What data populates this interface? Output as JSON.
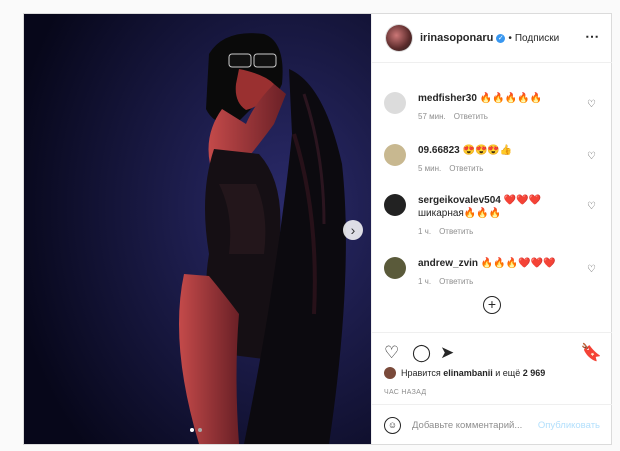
{
  "header": {
    "username": "irinasoponaru",
    "verified": "✓",
    "separator": "•",
    "follow_label": "Подписки",
    "more_icon": "⋯"
  },
  "comments": [
    {
      "user": "medfisher30",
      "text": "🔥🔥🔥🔥🔥",
      "time": "57 мин.",
      "reply": "Ответить",
      "avatar_color": "#dcdcdc"
    },
    {
      "user": "09.66823",
      "text": "😍😍😍👍",
      "time": "5 мин.",
      "reply": "Ответить",
      "avatar_color": "#c8b890"
    },
    {
      "user": "sergeikovalev504",
      "text": "❤️❤️❤️ шикарная🔥🔥🔥",
      "time": "1 ч.",
      "reply": "Ответить",
      "avatar_color": "#222222"
    },
    {
      "user": "andrew_zvin",
      "text": "🔥🔥🔥❤️❤️❤️",
      "time": "1 ч.",
      "reply": "Ответить",
      "avatar_color": "#5a5a3a"
    }
  ],
  "actions": {
    "like_icon": "♡",
    "comment_icon": "◯",
    "share_icon": "➤",
    "save_icon": "🔖"
  },
  "likes": {
    "prefix": "Нравится",
    "user": "elinambanii",
    "middle": "и ещё",
    "count": "2 969"
  },
  "timestamp": "ЧАС НАЗАД",
  "composer": {
    "emoji_icon": "☺",
    "placeholder": "Добавьте комментарий...",
    "publish_label": "Опубликовать"
  },
  "media": {
    "next_icon": "›",
    "dots": 2
  }
}
